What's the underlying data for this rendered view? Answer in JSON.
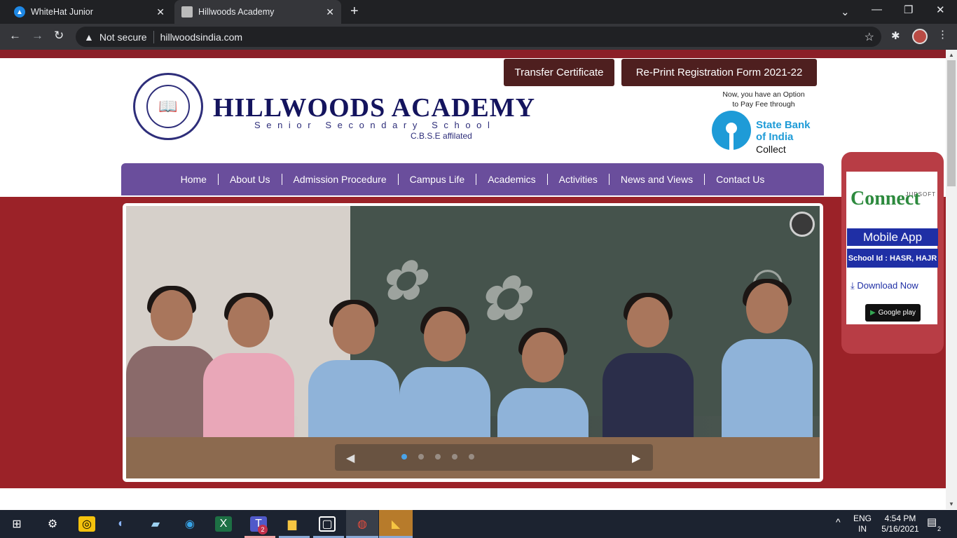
{
  "browser": {
    "tabs": [
      {
        "title": "WhiteHat Junior",
        "active": false
      },
      {
        "title": "Hillwoods Academy",
        "active": true
      }
    ],
    "security_label": "Not secure",
    "url": "hillwoodsindia.com"
  },
  "header": {
    "school_name": "HILLWOODS ACADEMY",
    "school_sub": "Senior Secondary School",
    "affiliation": "C.B.S.E affilated",
    "buttons": [
      "Transfer Certificate",
      "Re-Print Registration Form 2021-22"
    ],
    "fee_note_line1": "Now, you have an Option",
    "fee_note_line2": "to Pay Fee through",
    "bank_line1": "State Bank",
    "bank_line2": "of India",
    "bank_collect": "Collect"
  },
  "nav": {
    "items": [
      "Home",
      "About Us",
      "Admission Procedure",
      "Campus Life",
      "Academics",
      "Activities",
      "News and Views",
      "Contact Us"
    ]
  },
  "app_widget": {
    "brand_small": "JUPSOFT",
    "brand": "Connect",
    "title": "Mobile App",
    "school_id": "School Id : HASR, HAJR",
    "download": "Download Now",
    "store": "Google play"
  },
  "taskbar": {
    "lang_line1": "ENG",
    "lang_line2": "IN",
    "time": "4:54 PM",
    "date": "5/16/2021",
    "notifications": "2",
    "teams_badge": "2"
  },
  "colors": {
    "nav_bg": "#6a4e9c",
    "page_red": "#9b2228",
    "button_bg": "#4e1f1f",
    "sbi_blue": "#1e9bd7",
    "app_blue": "#1f2fa5"
  }
}
